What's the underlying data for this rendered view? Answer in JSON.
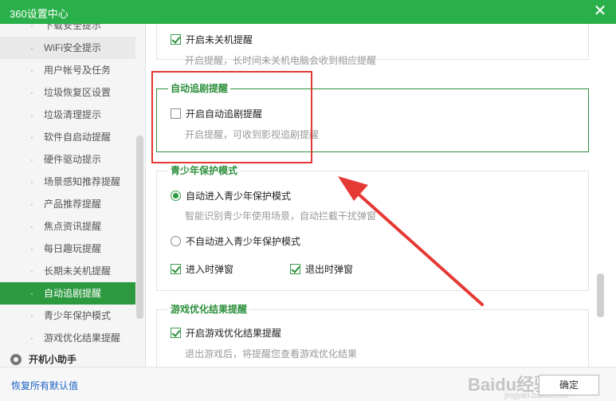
{
  "window": {
    "title": "360设置中心",
    "close_glyph": "✕"
  },
  "sidebar": {
    "items": [
      {
        "label": "下载安全提示"
      },
      {
        "label": "WiFi安全提示"
      },
      {
        "label": "用户帐号及任务"
      },
      {
        "label": "垃圾恢复区设置"
      },
      {
        "label": "垃圾清理提示"
      },
      {
        "label": "软件自启动提醒"
      },
      {
        "label": "硬件驱动提示"
      },
      {
        "label": "场景感知推荐提醒"
      },
      {
        "label": "产品推荐提醒"
      },
      {
        "label": "焦点资讯提醒"
      },
      {
        "label": "每日趣玩提醒"
      },
      {
        "label": "长期未关机提醒"
      },
      {
        "label": "自动追剧提醒"
      },
      {
        "label": "青少年保护模式"
      },
      {
        "label": "游戏优化结果提醒"
      }
    ],
    "active_index": 12,
    "section": {
      "label": "开机小助手",
      "icon": "gear-icon"
    }
  },
  "main": {
    "shutdown": {
      "checkbox_label": "开启未关机提醒",
      "checked": true,
      "desc": "开启提醒，长时间未关机电脑会收到相应提醒"
    },
    "drama": {
      "title": "自动追剧提醒",
      "checkbox_label": "开启自动追剧提醒",
      "checked": false,
      "desc": "开启提醒，可收到影视追剧提醒"
    },
    "teen": {
      "title": "青少年保护模式",
      "auto_label": "自动进入青少年保护模式",
      "auto_desc": "智能识别青少年使用场景，自动拦截干扰弹窗",
      "manual_label": "不自动进入青少年保护模式",
      "popup_enter": "进入时弹窗",
      "popup_exit": "退出时弹窗"
    },
    "game": {
      "title": "游戏优化结果提醒",
      "checkbox_label": "开启游戏优化结果提醒",
      "checked": true,
      "desc": "退出游戏后，将提醒您查看游戏优化结果"
    }
  },
  "footer": {
    "restore_label": "恢复所有默认值",
    "ok_label": "确定",
    "watermark": "Baidu经验",
    "watermark_sub": "jingyan.baidu.com"
  },
  "colors": {
    "titlebar": "#2ab04a",
    "accent_green": "#2d8f3c",
    "active_item": "#2d9a3f",
    "annotation_red": "#e53935",
    "link_blue": "#1b62c4"
  }
}
